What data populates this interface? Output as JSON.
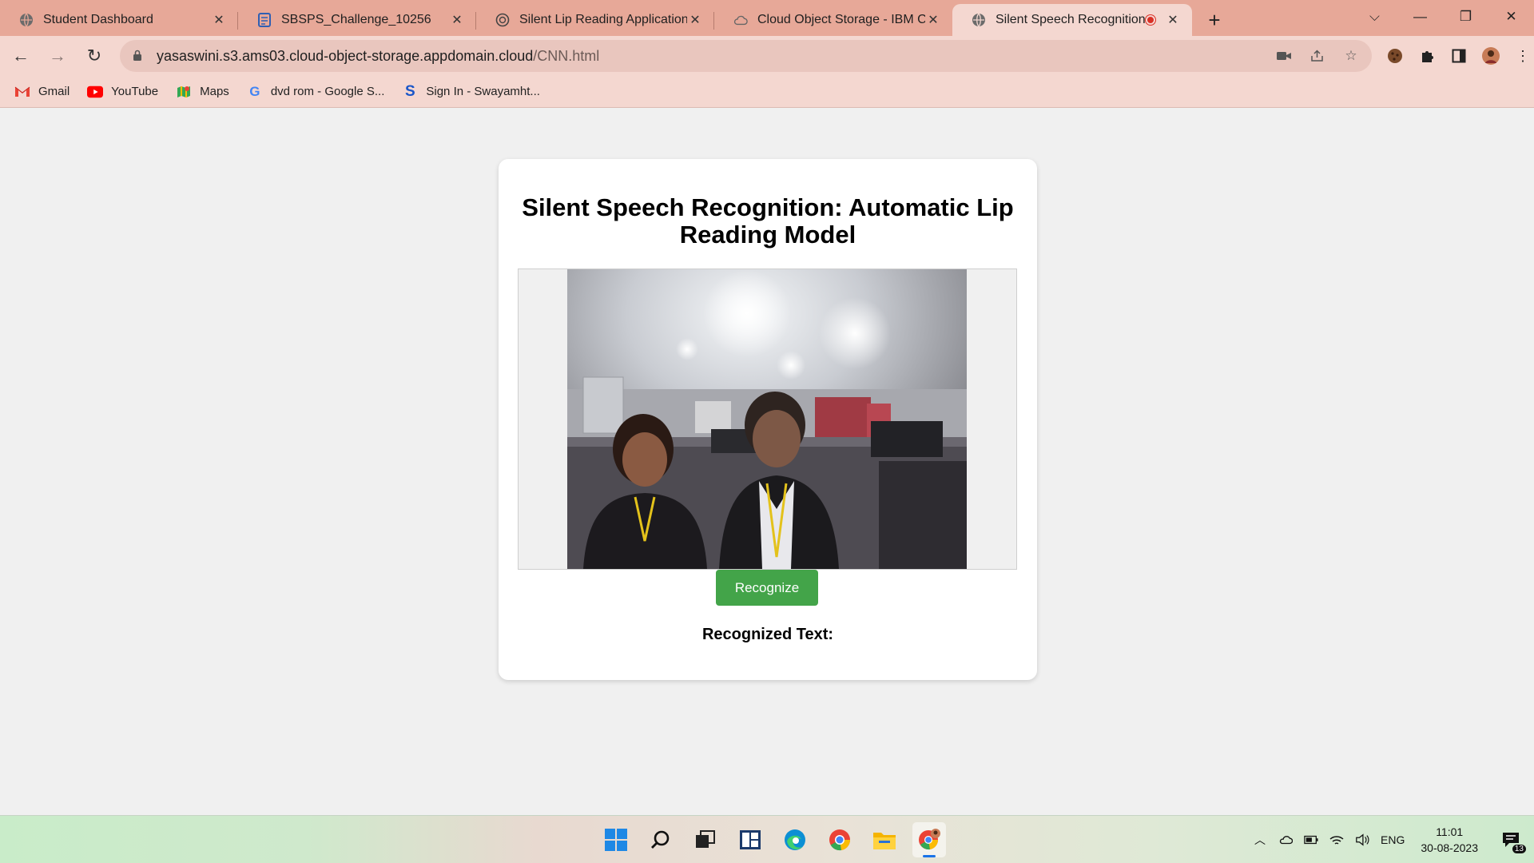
{
  "browser": {
    "tabs": [
      {
        "title": "Student Dashboard",
        "icon": "globe-icon"
      },
      {
        "title": "SBSPS_Challenge_10256",
        "icon": "form-icon"
      },
      {
        "title": "Silent Lip Reading Applications",
        "icon": "chatgpt-icon"
      },
      {
        "title": "Cloud Object Storage - IBM Clou",
        "icon": "cloud-icon"
      },
      {
        "title": "Silent Speech Recognition: Li",
        "icon": "globe-icon",
        "active": true,
        "recording": true
      }
    ],
    "url_host": "yasaswini.s3.ams03.cloud-object-storage.appdomain.cloud",
    "url_path": "/CNN.html",
    "bookmarks": [
      {
        "label": "Gmail",
        "icon": "gmail-icon"
      },
      {
        "label": "YouTube",
        "icon": "youtube-icon"
      },
      {
        "label": "Maps",
        "icon": "maps-icon"
      },
      {
        "label": "dvd rom - Google S...",
        "icon": "google-icon"
      },
      {
        "label": "Sign In - Swayamht...",
        "icon": "swayam-icon"
      }
    ]
  },
  "page": {
    "title": "Silent Speech Recognition: Automatic Lip Reading Model",
    "recognize_button": "Recognize",
    "result_label": "Recognized Text:"
  },
  "taskbar": {
    "language": "ENG",
    "time": "11:01",
    "date": "30-08-2023",
    "notifications": "13"
  },
  "colors": {
    "tabbar": "#e7a898",
    "toolbar": "#f4d7d0",
    "button_green": "#43a449"
  }
}
